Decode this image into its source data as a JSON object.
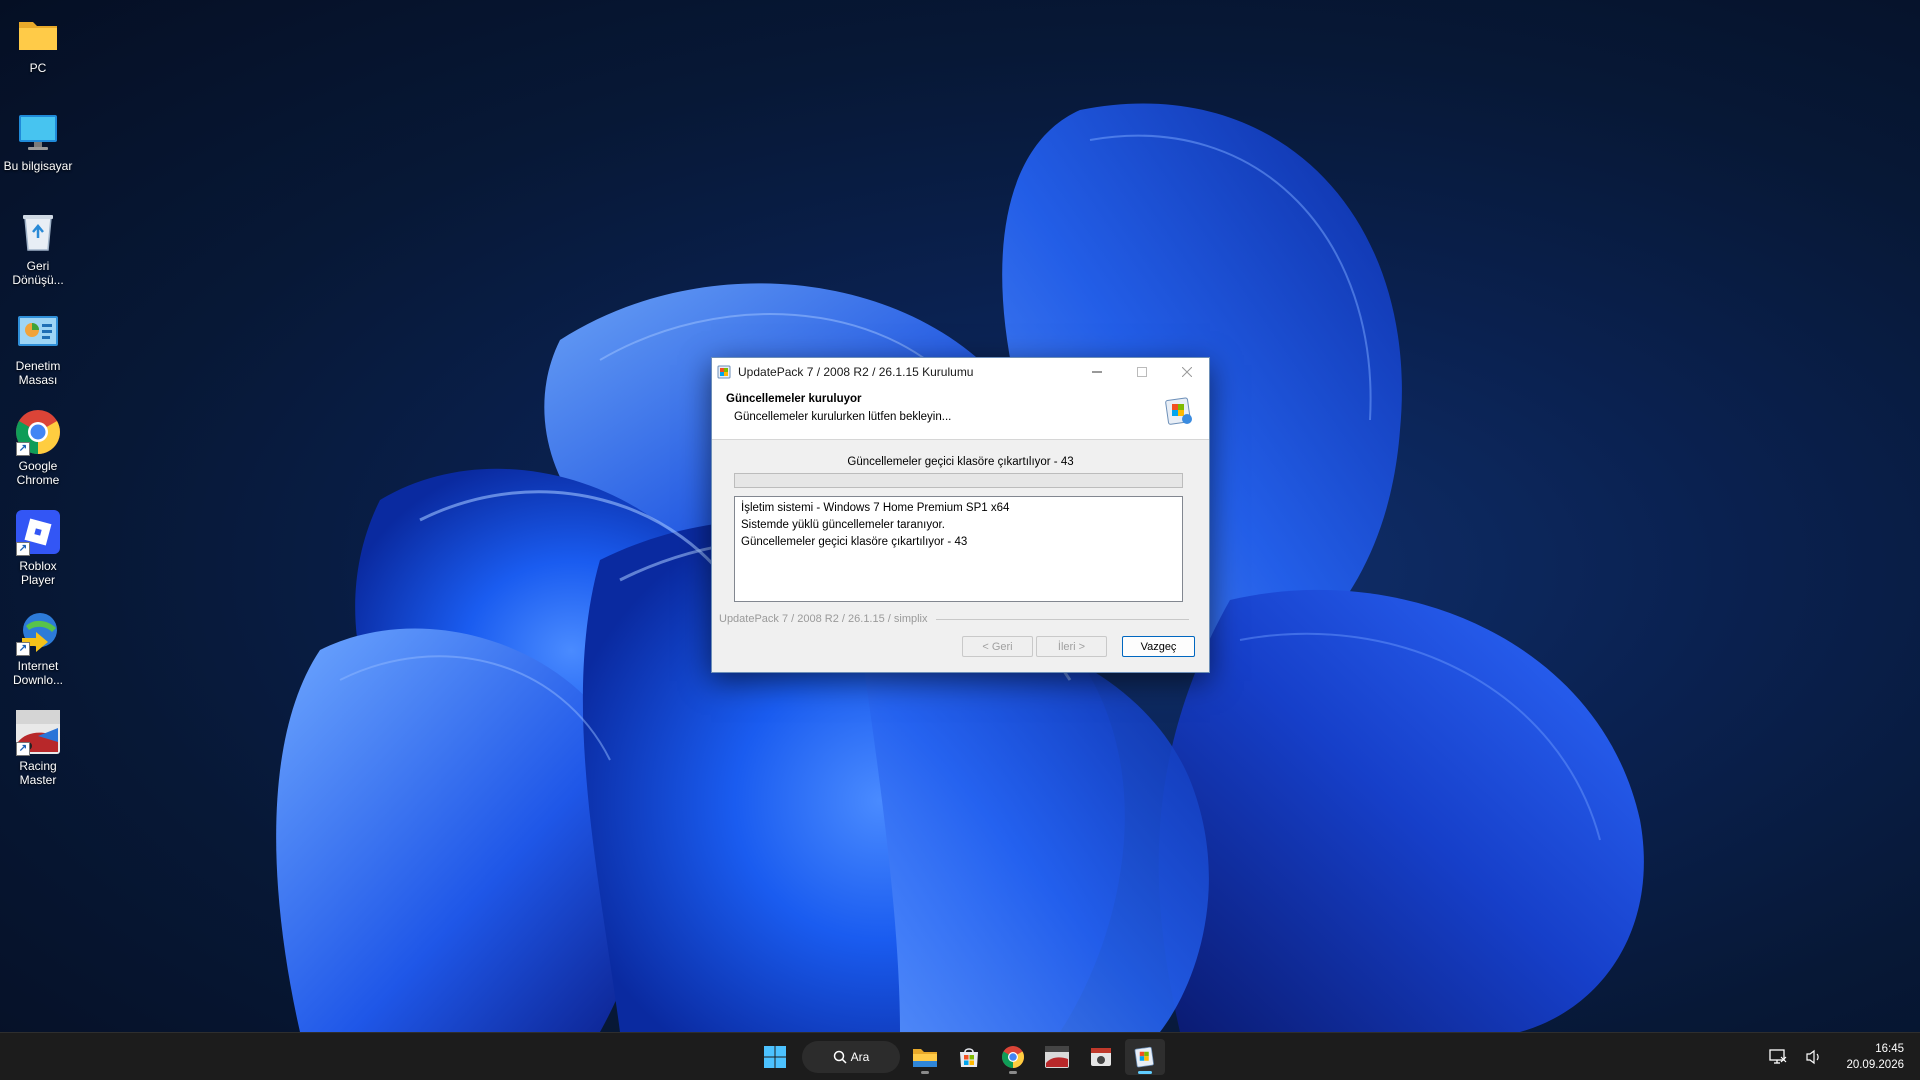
{
  "desktop": {
    "icons": [
      {
        "label": "PC",
        "icon": "folder-icon"
      },
      {
        "label": "Bu bilgisayar",
        "icon": "monitor-icon"
      },
      {
        "label": "Geri Dönüşü...",
        "icon": "recycle-bin-icon"
      },
      {
        "label": "Denetim Masası",
        "icon": "control-panel-icon"
      },
      {
        "label": "Google Chrome",
        "icon": "chrome-icon"
      },
      {
        "label": "Roblox Player",
        "icon": "roblox-icon"
      },
      {
        "label": "Internet Downlo...",
        "icon": "idm-icon"
      },
      {
        "label": "Racing Master",
        "icon": "racing-master-icon"
      }
    ]
  },
  "dialog": {
    "title": "UpdatePack 7 / 2008 R2 / 26.1.15 Kurulumu",
    "header_title": "Güncellemeler kuruluyor",
    "header_subtitle": "Güncellemeler kurulurken lütfen bekleyin...",
    "status": "Güncellemeler geçici klasöre çıkartılıyor - 43",
    "progress": 0.0,
    "log": [
      "İşletim sistemi - Windows 7 Home Premium SP1 x64",
      "Sistemde yüklü güncellemeler taranıyor.",
      "Güncellemeler geçici klasöre çıkartılıyor - 43"
    ],
    "brand": "UpdatePack 7 / 2008 R2 / 26.1.15 / simplix",
    "buttons": {
      "back": "< Geri",
      "next": "İleri >",
      "cancel": "Vazgeç"
    }
  },
  "taskbar": {
    "search_label": "Ara",
    "apps": [
      "start-icon",
      "file-explorer-icon",
      "microsoft-store-icon",
      "chrome-icon",
      "racing-master-icon",
      "app-icon",
      "updatepack-icon"
    ],
    "clock_time": "16:45",
    "clock_date": "20.09.2026"
  },
  "colors": {
    "accent": "#0067c0",
    "progress": "#06b025",
    "taskbar": "#1c1c1c"
  }
}
